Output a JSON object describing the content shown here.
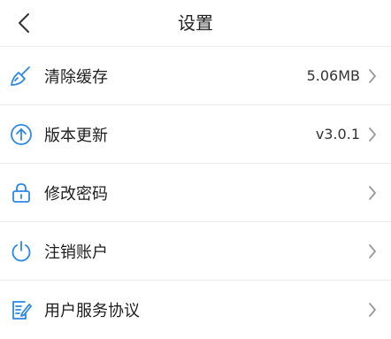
{
  "header": {
    "title": "设置",
    "back_icon": "chevron-left-icon"
  },
  "colors": {
    "icon_blue": "#2b88e0",
    "chevron": "#9a9a9a",
    "background": "#f4f4f4"
  },
  "items": [
    {
      "label": "清除缓存",
      "value": "5.06MB",
      "icon": "broom-icon"
    },
    {
      "label": "版本更新",
      "value": "v3.0.1",
      "icon": "arrow-up-circle-icon"
    },
    {
      "label": "修改密码",
      "value": "",
      "icon": "lock-icon"
    },
    {
      "label": "注销账户",
      "value": "",
      "icon": "power-icon"
    },
    {
      "label": "用户服务协议",
      "value": "",
      "icon": "document-edit-icon"
    }
  ]
}
